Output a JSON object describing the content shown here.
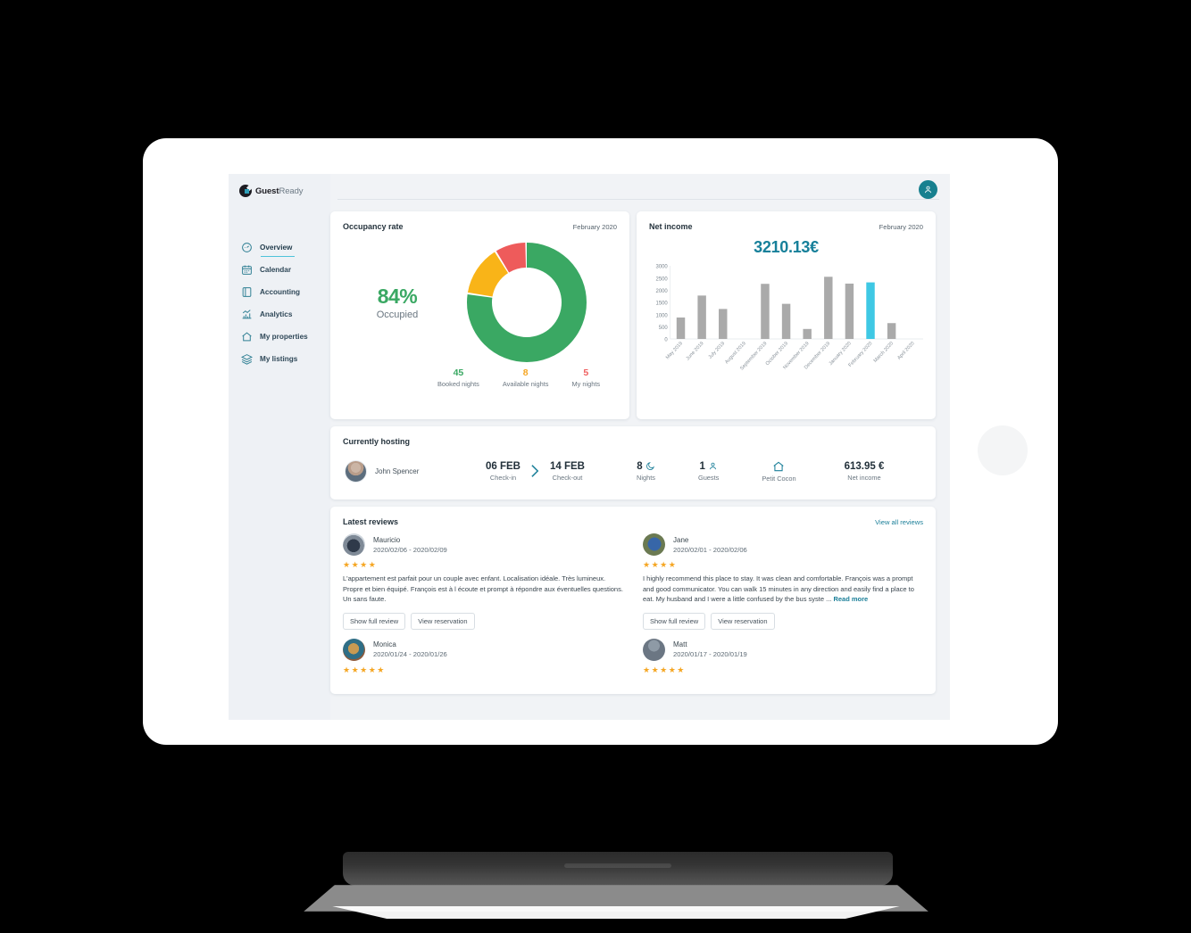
{
  "brand": {
    "bold": "Guest",
    "light": "Ready"
  },
  "sidebar": {
    "items": [
      {
        "label": "Overview",
        "icon": "gauge-icon"
      },
      {
        "label": "Calendar",
        "icon": "calendar-icon"
      },
      {
        "label": "Accounting",
        "icon": "book-icon"
      },
      {
        "label": "Analytics",
        "icon": "chart-icon"
      },
      {
        "label": "My properties",
        "icon": "home-icon"
      },
      {
        "label": "My listings",
        "icon": "layers-icon"
      }
    ]
  },
  "topbar": {
    "avatar_icon": "user-icon",
    "avatar_color": "#17808f"
  },
  "occupancy": {
    "title": "Occupancy rate",
    "period": "February 2020",
    "percent": "84%",
    "percent_label": "Occupied",
    "stats": [
      {
        "value": "45",
        "label": "Booked nights",
        "color": "#3aa863"
      },
      {
        "value": "8",
        "label": "Available nights",
        "color": "#f5a623"
      },
      {
        "value": "5",
        "label": "My nights",
        "color": "#ef5f5f"
      }
    ]
  },
  "income": {
    "title": "Net income",
    "period": "February 2020",
    "value": "3210.13€"
  },
  "chart_data": [
    {
      "type": "pie",
      "title": "Occupancy rate",
      "labels": [
        "Booked nights",
        "Available nights",
        "My nights"
      ],
      "values": [
        45,
        8,
        5
      ],
      "colors": [
        "#3aa863",
        "#f9b418",
        "#ee5b5b"
      ],
      "donut": true,
      "center_label": "84% Occupied",
      "legend": "bottom"
    },
    {
      "type": "bar",
      "title": "Net income",
      "categories": [
        "May 2019",
        "June 2019",
        "July 2019",
        "August 2019",
        "September 2019",
        "October 2019",
        "November 2019",
        "December 2019",
        "January 2020",
        "February 2020",
        "March 2020",
        "April 2020"
      ],
      "values": [
        880,
        1780,
        1230,
        0,
        2260,
        1440,
        410,
        2550,
        2270,
        2320,
        650,
        0
      ],
      "highlight_index": 9,
      "bar_color": "#aaaaaa",
      "highlight_color": "#3fc8e4",
      "xlabel": "",
      "ylabel": "",
      "ylim": [
        0,
        3000
      ],
      "yticks": [
        0,
        500,
        1000,
        1500,
        2000,
        2500,
        3000
      ],
      "grid": false,
      "legend": "none"
    }
  ],
  "hosting": {
    "title": "Currently hosting",
    "guest_name": "John Spencer",
    "checkin": {
      "value": "06 FEB",
      "label": "Check-in"
    },
    "checkout": {
      "value": "14 FEB",
      "label": "Check-out"
    },
    "nights": {
      "value": "8",
      "label": "Nights",
      "icon": "moon-icon"
    },
    "guests": {
      "value": "1",
      "label": "Guests",
      "icon": "user-icon"
    },
    "property": {
      "label": "Petit Cocon",
      "icon": "home-icon"
    },
    "net_income": {
      "value": "613.95 €",
      "label": "Net income"
    }
  },
  "reviews": {
    "title": "Latest reviews",
    "view_all": "View all reviews",
    "buttons": {
      "show_full": "Show full review",
      "view_reservation": "View reservation"
    },
    "items": [
      {
        "name": "Mauricio",
        "dates": "2020/02/06 - 2020/02/09",
        "stars": 4,
        "text": "L'appartement est parfait pour un couple avec enfant. Localisation idéale. Très lumineux. Propre et bien équipé. François est à l écoute et prompt à répondre aux éventuelles questions. Un sans faute.",
        "read_more": ""
      },
      {
        "name": "Jane",
        "dates": "2020/02/01 - 2020/02/06",
        "stars": 4,
        "text": "I highly recommend this place to stay. It was clean and comfortable. François was a prompt and good communicator. You can walk 15 minutes in any direction and easily find a place to eat. My husband and I were a little confused by the bus syste ... ",
        "read_more": "Read more"
      },
      {
        "name": "Monica",
        "dates": "2020/01/24 - 2020/01/26",
        "stars": 5,
        "text": "",
        "read_more": ""
      },
      {
        "name": "Matt",
        "dates": "2020/01/17 - 2020/01/19",
        "stars": 5,
        "text": "",
        "read_more": ""
      }
    ]
  }
}
